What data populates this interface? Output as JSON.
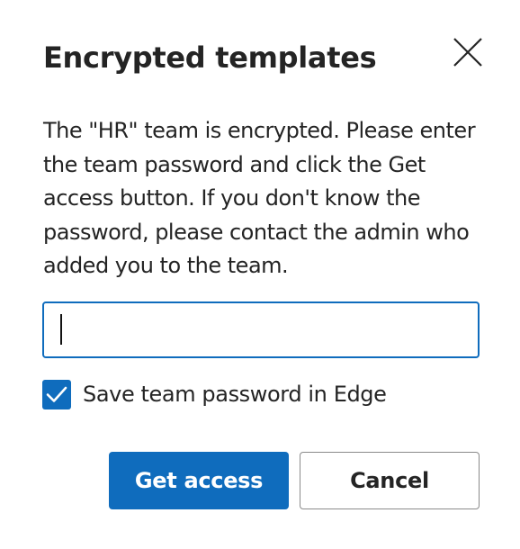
{
  "dialog": {
    "title": "Encrypted templates",
    "close_icon": "close-icon",
    "message": "The \"HR\" team is encrypted. Please enter the team password and click the Get access button. If you don't know the password, please contact the admin who added you to the team.",
    "password": {
      "value": "",
      "placeholder": ""
    },
    "save_password": {
      "label": "Save team password in Edge",
      "checked": true,
      "check_icon": "checkmark-icon"
    },
    "buttons": {
      "primary_label": "Get access",
      "secondary_label": "Cancel"
    }
  },
  "colors": {
    "accent": "#0f6cbd",
    "text": "#242424",
    "background": "#ffffff",
    "secondary_border": "#8a8a8a"
  }
}
